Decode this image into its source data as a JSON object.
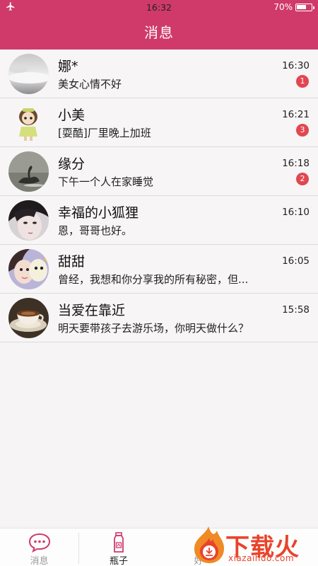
{
  "status_bar": {
    "time": "16:32",
    "battery": "70%",
    "battery_level": 0.7,
    "icons": [
      "airplane-icon",
      "battery-icon"
    ]
  },
  "header": {
    "title": "消息"
  },
  "accent_color": "#cf3a6b",
  "badge_color": "#e14751",
  "conversations": [
    {
      "name": "娜*",
      "message": "美女心情不好",
      "time": "16:30",
      "unread": "1",
      "avatar": "sky-photo"
    },
    {
      "name": "小美",
      "message": "[耍酷]厂里晚上加班",
      "time": "16:21",
      "unread": "3",
      "avatar": "doll-figure"
    },
    {
      "name": "缘分",
      "message": "下午一个人在家睡觉",
      "time": "16:18",
      "unread": "2",
      "avatar": "swan-photo"
    },
    {
      "name": "幸福的小狐狸",
      "message": "恩，哥哥也好。",
      "time": "16:10",
      "unread": "",
      "avatar": "girl-portrait"
    },
    {
      "name": "甜甜",
      "message": "曾经，我想和你分享我的所有秘密，但...",
      "time": "16:05",
      "unread": "",
      "avatar": "girl-with-plush"
    },
    {
      "name": "当爱在靠近",
      "message": "明天要带孩子去游乐场，你明天做什么？",
      "time": "15:58",
      "unread": "",
      "avatar": "coffee-cup"
    }
  ],
  "tabbar": {
    "tabs": [
      {
        "label": "消息",
        "icon": "chat-bubble-icon",
        "active": true,
        "color": "#cf3a6b"
      },
      {
        "label": "瓶子",
        "icon": "bottle-icon",
        "active": false,
        "color": "#cf3a6b"
      },
      {
        "label": "好",
        "icon": "friends-icon",
        "active": false
      }
    ]
  },
  "watermark": {
    "text": "下载火",
    "url": "xiazaihuo.com"
  }
}
